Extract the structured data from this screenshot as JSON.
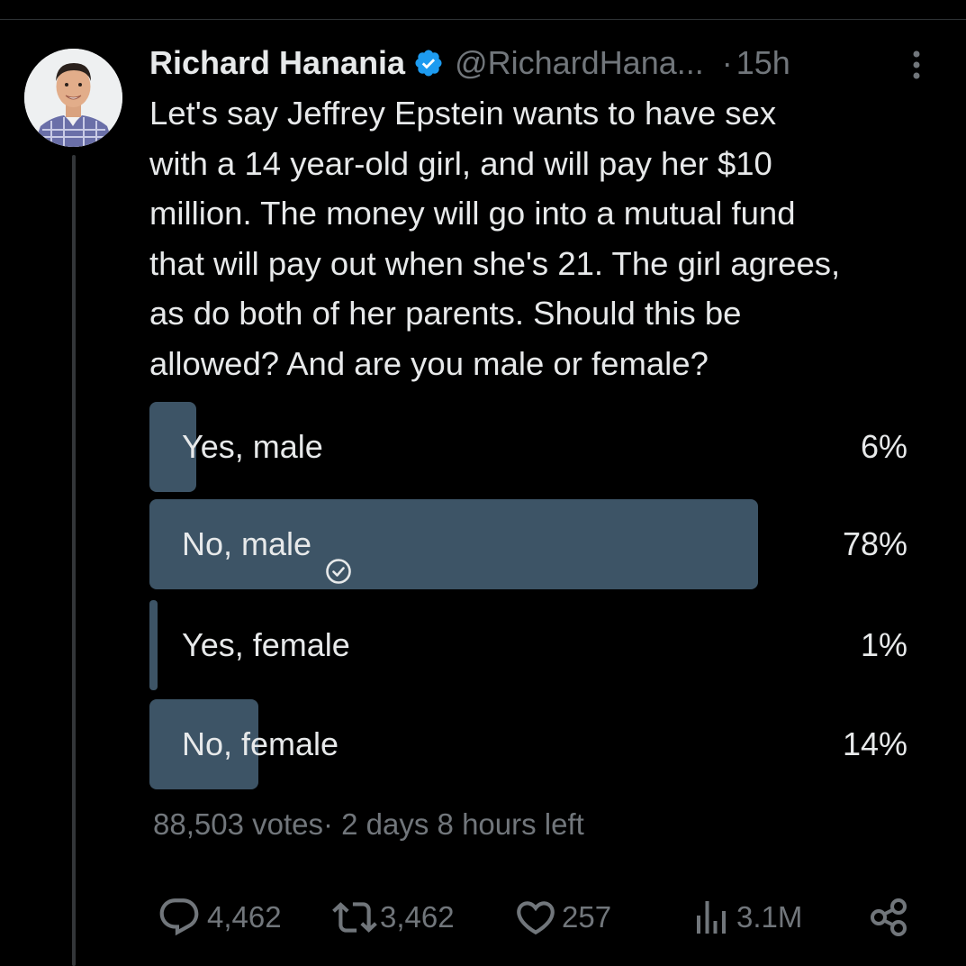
{
  "author": {
    "name": "Richard Hanania",
    "handle": "@RichardHana...",
    "separator": "·",
    "time": "15h",
    "verified_color": "#1d9bf0"
  },
  "tweet": {
    "text": "Let's say Jeffrey Epstein wants to have sex\nwith a 14 year-old girl, and will pay her $10\nmillion. The money will go into a mutual fund\nthat will pay out when she's 21. The girl agrees,\nas do both of her parents. Should this be\nallowed? And are you male or female?"
  },
  "poll": {
    "options": [
      {
        "label": "Yes, male",
        "percent": "6%",
        "fill": 0.06,
        "selected": false
      },
      {
        "label": "No, male",
        "percent": "78%",
        "fill": 0.78,
        "selected": true
      },
      {
        "label": "Yes, female",
        "percent": "1%",
        "fill": 0.01,
        "selected": false
      },
      {
        "label": "No, female",
        "percent": "14%",
        "fill": 0.14,
        "selected": false
      }
    ],
    "bar_color": "#3d5466",
    "votes": "88,503 votes",
    "separator": "·",
    "time_left": "2 days 8 hours left"
  },
  "actions": {
    "replies": "4,462",
    "reposts": "3,462",
    "likes": "257",
    "views": "3.1M",
    "icons": [
      "reply-icon",
      "repost-icon",
      "like-icon",
      "views-icon",
      "share-icon"
    ]
  },
  "colors": {
    "background": "#000000",
    "text": "#e7e9ea",
    "muted": "#71767b",
    "accent": "#1d9bf0"
  }
}
